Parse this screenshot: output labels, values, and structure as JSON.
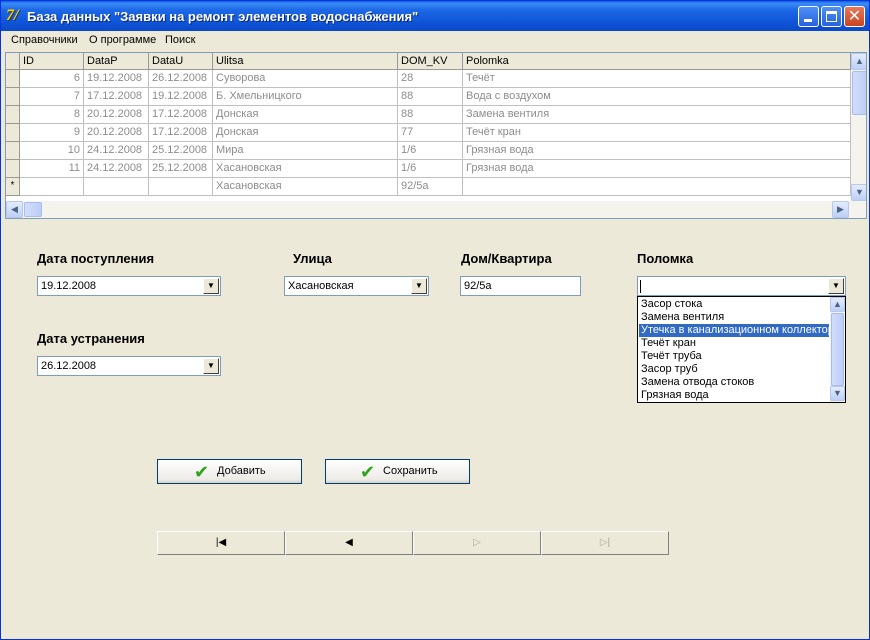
{
  "window": {
    "title": "База данных \"Заявки на ремонт элементов водоснабжения\"",
    "icon": "7/"
  },
  "menu": [
    "Справочники",
    "О программе",
    "Поиск"
  ],
  "grid": {
    "columns": [
      "ID",
      "DataP",
      "DataU",
      "Ulitsa",
      "DOM_KV",
      "Polomka"
    ],
    "rows": [
      [
        "6",
        "19.12.2008",
        "26.12.2008",
        "Суворова",
        "28",
        "Течёт"
      ],
      [
        "7",
        "17.12.2008",
        "19.12.2008",
        "Б. Хмельницкого",
        "88",
        "Вода с воздухом"
      ],
      [
        "8",
        "20.12.2008",
        "17.12.2008",
        "Донская",
        "88",
        "Замена вентиля"
      ],
      [
        "9",
        "20.12.2008",
        "17.12.2008",
        "Донская",
        "77",
        "Течёт кран"
      ],
      [
        "10",
        "24.12.2008",
        "25.12.2008",
        "Мира",
        "1/6",
        "Грязная вода"
      ],
      [
        "11",
        "24.12.2008",
        "25.12.2008",
        "Хасановская",
        "1/6",
        "Грязная вода"
      ],
      [
        "",
        "",
        "",
        "Хасановская",
        "92/5а",
        ""
      ]
    ],
    "new_row_marker": "*"
  },
  "form": {
    "date_in_label": "Дата поступления",
    "date_in_value": "19.12.2008",
    "date_out_label": "Дата устранения",
    "date_out_value": "26.12.2008",
    "street_label": "Улица",
    "street_value": "Хасановская",
    "house_label": "Дом/Квартира",
    "house_value": "92/5а",
    "fault_label": "Поломка",
    "fault_value": "",
    "fault_options": [
      "Засор стока",
      "Замена вентиля",
      "Утечка в канализационном коллекторе",
      "Течёт кран",
      "Течёт труба",
      "Засор труб",
      "Замена отвода стоков",
      "Грязная вода"
    ],
    "fault_selected_index": 2
  },
  "buttons": {
    "add": "Добавить",
    "save": "Сохранить"
  },
  "navigator": {
    "first": "|◀",
    "prior": "◀",
    "next": "▷",
    "last": "▷|"
  }
}
